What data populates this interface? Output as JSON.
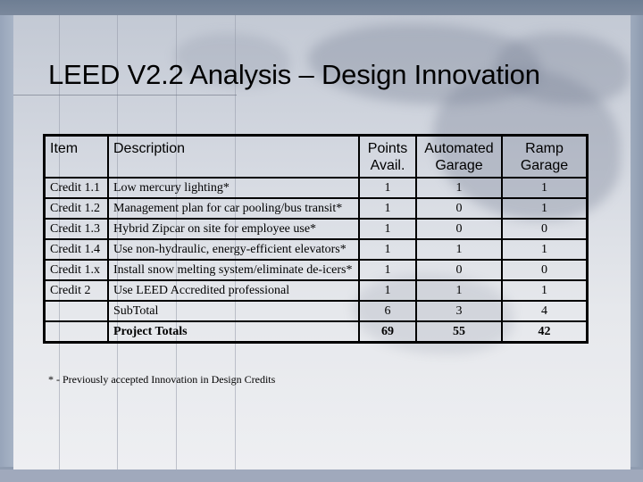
{
  "title": "LEED V2.2 Analysis – Design Innovation",
  "table": {
    "headers": {
      "item": "Item",
      "description": "Description",
      "points_line1": "Points",
      "points_line2": "Avail.",
      "automated_line1": "Automated",
      "automated_line2": "Garage",
      "ramp_line1": "Ramp",
      "ramp_line2": "Garage"
    },
    "rows": [
      {
        "item": "Credit 1.1",
        "description": "Low mercury lighting*",
        "points": "1",
        "automated": "1",
        "ramp": "1"
      },
      {
        "item": "Credit 1.2",
        "description": "Management plan for car pooling/bus transit*",
        "points": "1",
        "automated": "0",
        "ramp": "1"
      },
      {
        "item": "Credit 1.3",
        "description": "Hybrid Zipcar on site for employee use*",
        "points": "1",
        "automated": "0",
        "ramp": "0"
      },
      {
        "item": "Credit 1.4",
        "description": "Use non-hydraulic, energy-efficient elevators*",
        "points": "1",
        "automated": "1",
        "ramp": "1"
      },
      {
        "item": "Credit 1.x",
        "description": "Install snow melting system/eliminate de-icers*",
        "points": "1",
        "automated": "0",
        "ramp": "0"
      },
      {
        "item": "Credit 2",
        "description": "Use LEED Accredited professional",
        "points": "1",
        "automated": "1",
        "ramp": "1"
      }
    ],
    "subtotal": {
      "label": "SubTotal",
      "points": "6",
      "automated": "3",
      "ramp": "4"
    },
    "totals": {
      "label": "Project Totals",
      "points": "69",
      "automated": "55",
      "ramp": "42"
    }
  },
  "footnote": "* - Previously accepted Innovation in Design Credits"
}
